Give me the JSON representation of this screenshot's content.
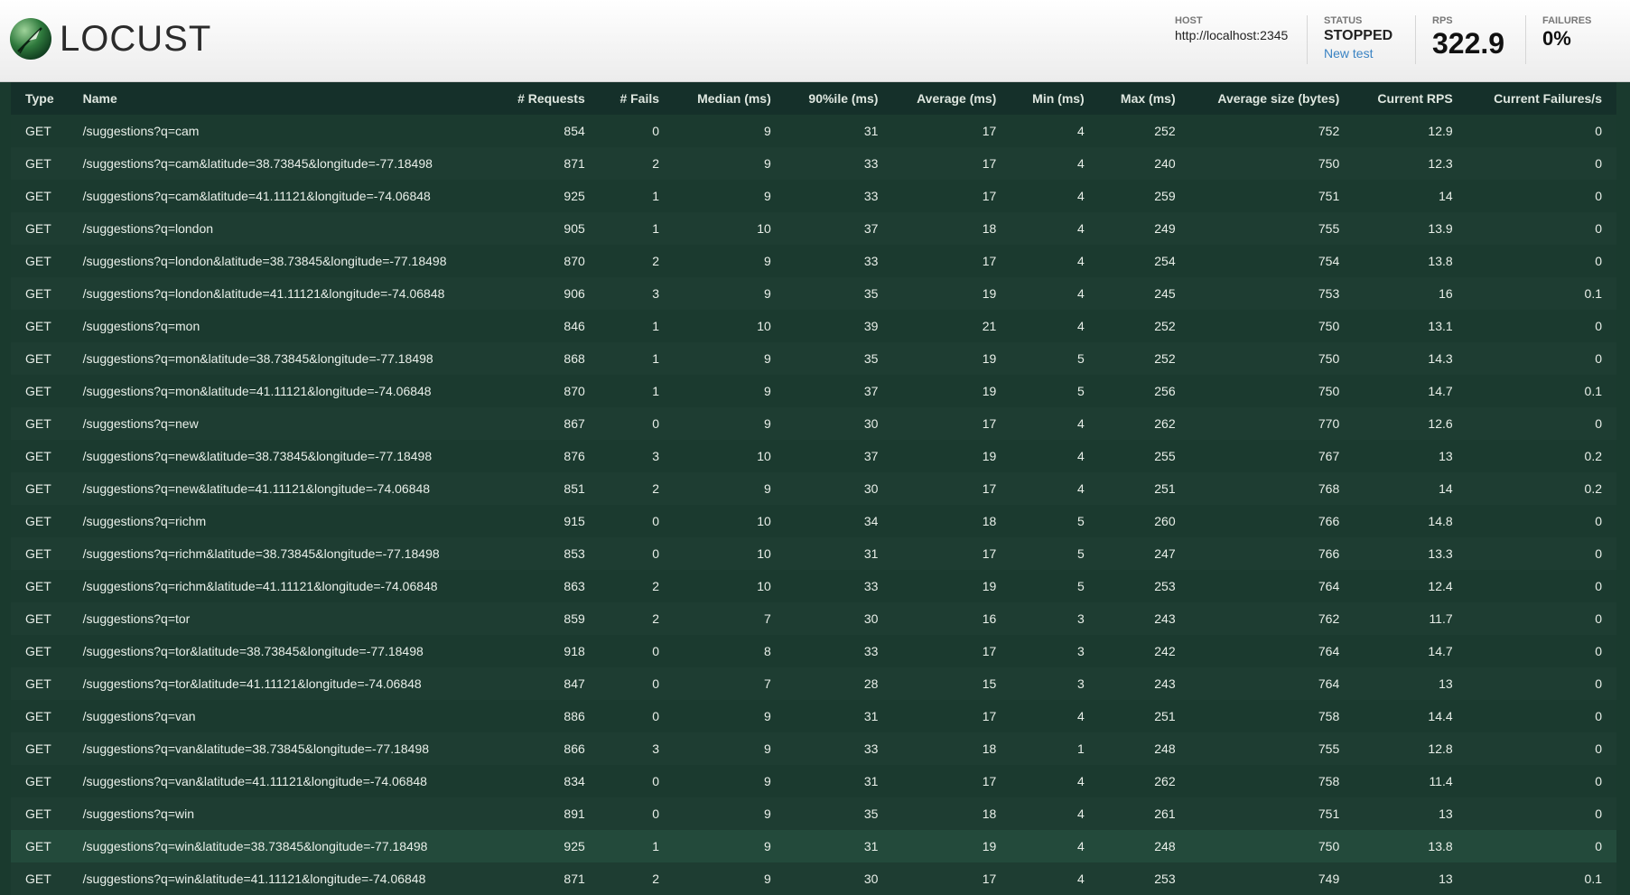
{
  "brand": {
    "name": "LOCUST"
  },
  "header": {
    "host_label": "HOST",
    "host_value": "http://localhost:2345",
    "status_label": "STATUS",
    "status_value": "STOPPED",
    "new_test_label": "New test",
    "rps_label": "RPS",
    "rps_value": "322.9",
    "failures_label": "FAILURES",
    "failures_value": "0%"
  },
  "table": {
    "columns": [
      "Type",
      "Name",
      "# Requests",
      "# Fails",
      "Median (ms)",
      "90%ile (ms)",
      "Average (ms)",
      "Min (ms)",
      "Max (ms)",
      "Average size (bytes)",
      "Current RPS",
      "Current Failures/s"
    ],
    "rows": [
      [
        "GET",
        "/suggestions?q=cam",
        "854",
        "0",
        "9",
        "31",
        "17",
        "4",
        "252",
        "752",
        "12.9",
        "0"
      ],
      [
        "GET",
        "/suggestions?q=cam&latitude=38.73845&longitude=-77.18498",
        "871",
        "2",
        "9",
        "33",
        "17",
        "4",
        "240",
        "750",
        "12.3",
        "0"
      ],
      [
        "GET",
        "/suggestions?q=cam&latitude=41.11121&longitude=-74.06848",
        "925",
        "1",
        "9",
        "33",
        "17",
        "4",
        "259",
        "751",
        "14",
        "0"
      ],
      [
        "GET",
        "/suggestions?q=london",
        "905",
        "1",
        "10",
        "37",
        "18",
        "4",
        "249",
        "755",
        "13.9",
        "0"
      ],
      [
        "GET",
        "/suggestions?q=london&latitude=38.73845&longitude=-77.18498",
        "870",
        "2",
        "9",
        "33",
        "17",
        "4",
        "254",
        "754",
        "13.8",
        "0"
      ],
      [
        "GET",
        "/suggestions?q=london&latitude=41.11121&longitude=-74.06848",
        "906",
        "3",
        "9",
        "35",
        "19",
        "4",
        "245",
        "753",
        "16",
        "0.1"
      ],
      [
        "GET",
        "/suggestions?q=mon",
        "846",
        "1",
        "10",
        "39",
        "21",
        "4",
        "252",
        "750",
        "13.1",
        "0"
      ],
      [
        "GET",
        "/suggestions?q=mon&latitude=38.73845&longitude=-77.18498",
        "868",
        "1",
        "9",
        "35",
        "19",
        "5",
        "252",
        "750",
        "14.3",
        "0"
      ],
      [
        "GET",
        "/suggestions?q=mon&latitude=41.11121&longitude=-74.06848",
        "870",
        "1",
        "9",
        "37",
        "19",
        "5",
        "256",
        "750",
        "14.7",
        "0.1"
      ],
      [
        "GET",
        "/suggestions?q=new",
        "867",
        "0",
        "9",
        "30",
        "17",
        "4",
        "262",
        "770",
        "12.6",
        "0"
      ],
      [
        "GET",
        "/suggestions?q=new&latitude=38.73845&longitude=-77.18498",
        "876",
        "3",
        "10",
        "37",
        "19",
        "4",
        "255",
        "767",
        "13",
        "0.2"
      ],
      [
        "GET",
        "/suggestions?q=new&latitude=41.11121&longitude=-74.06848",
        "851",
        "2",
        "9",
        "30",
        "17",
        "4",
        "251",
        "768",
        "14",
        "0.2"
      ],
      [
        "GET",
        "/suggestions?q=richm",
        "915",
        "0",
        "10",
        "34",
        "18",
        "5",
        "260",
        "766",
        "14.8",
        "0"
      ],
      [
        "GET",
        "/suggestions?q=richm&latitude=38.73845&longitude=-77.18498",
        "853",
        "0",
        "10",
        "31",
        "17",
        "5",
        "247",
        "766",
        "13.3",
        "0"
      ],
      [
        "GET",
        "/suggestions?q=richm&latitude=41.11121&longitude=-74.06848",
        "863",
        "2",
        "10",
        "33",
        "19",
        "5",
        "253",
        "764",
        "12.4",
        "0"
      ],
      [
        "GET",
        "/suggestions?q=tor",
        "859",
        "2",
        "7",
        "30",
        "16",
        "3",
        "243",
        "762",
        "11.7",
        "0"
      ],
      [
        "GET",
        "/suggestions?q=tor&latitude=38.73845&longitude=-77.18498",
        "918",
        "0",
        "8",
        "33",
        "17",
        "3",
        "242",
        "764",
        "14.7",
        "0"
      ],
      [
        "GET",
        "/suggestions?q=tor&latitude=41.11121&longitude=-74.06848",
        "847",
        "0",
        "7",
        "28",
        "15",
        "3",
        "243",
        "764",
        "13",
        "0"
      ],
      [
        "GET",
        "/suggestions?q=van",
        "886",
        "0",
        "9",
        "31",
        "17",
        "4",
        "251",
        "758",
        "14.4",
        "0"
      ],
      [
        "GET",
        "/suggestions?q=van&latitude=38.73845&longitude=-77.18498",
        "866",
        "3",
        "9",
        "33",
        "18",
        "1",
        "248",
        "755",
        "12.8",
        "0"
      ],
      [
        "GET",
        "/suggestions?q=van&latitude=41.11121&longitude=-74.06848",
        "834",
        "0",
        "9",
        "31",
        "17",
        "4",
        "262",
        "758",
        "11.4",
        "0"
      ],
      [
        "GET",
        "/suggestions?q=win",
        "891",
        "0",
        "9",
        "35",
        "18",
        "4",
        "261",
        "751",
        "13",
        "0"
      ],
      [
        "GET",
        "/suggestions?q=win&latitude=38.73845&longitude=-77.18498",
        "925",
        "1",
        "9",
        "31",
        "19",
        "4",
        "248",
        "750",
        "13.8",
        "0"
      ],
      [
        "GET",
        "/suggestions?q=win&latitude=41.11121&longitude=-74.06848",
        "871",
        "2",
        "9",
        "30",
        "17",
        "4",
        "253",
        "749",
        "13",
        "0.1"
      ]
    ],
    "hovered_row": 22
  },
  "colors": {
    "background": "#1a3a2e",
    "header_bar": "#ffffff",
    "link": "#3a83c3"
  }
}
